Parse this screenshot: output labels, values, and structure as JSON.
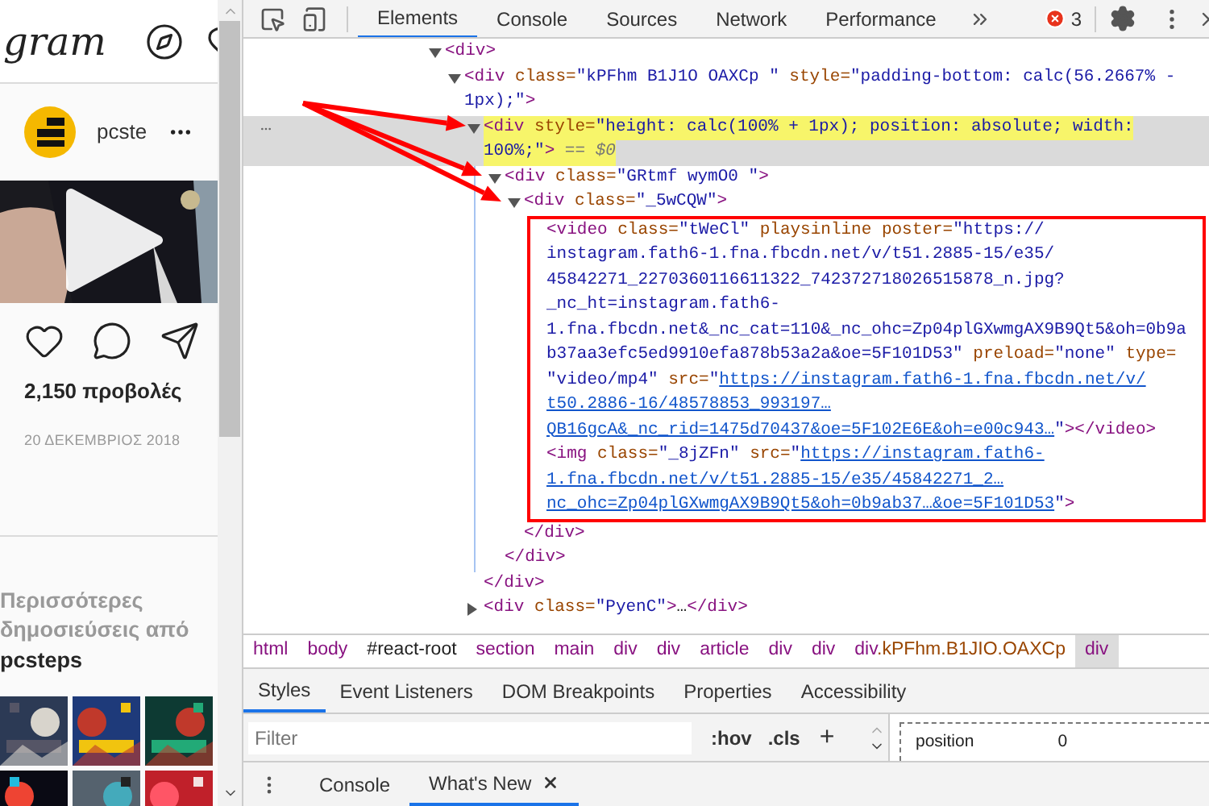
{
  "page": {
    "logo": "gram",
    "post": {
      "username": "pcste",
      "views": "2,150 προβολές",
      "date": "20 ΔΕΚΕΜΒΡΙΟΣ 2018"
    },
    "more": {
      "heading": "Περισσότερες δημοσιεύσεις από",
      "account": "pcsteps"
    }
  },
  "devtools": {
    "tabs": [
      {
        "label": "Elements",
        "selected": true
      },
      {
        "label": "Console",
        "selected": false
      },
      {
        "label": "Sources",
        "selected": false
      },
      {
        "label": "Network",
        "selected": false
      },
      {
        "label": "Performance",
        "selected": false
      }
    ],
    "error_count": "3",
    "annotations": {
      "arrows": true
    },
    "dom": {
      "kind": "parent",
      "expanded": true,
      "selected": false,
      "lines": [
        [
          {
            "kind": "tag",
            "text": "<div>"
          }
        ]
      ],
      "children": [
        {
          "kind": "parent",
          "expanded": true,
          "selected": false,
          "lines": [
            [
              {
                "kind": "tag",
                "text": "<div"
              },
              {
                "kind": "attr",
                "text": " class"
              },
              {
                "kind": "eq",
                "text": "="
              },
              {
                "kind": "val",
                "text": "\"kPFhm B1J1O OAXCp \""
              },
              {
                "kind": "attr",
                "text": " style"
              },
              {
                "kind": "eq",
                "text": "="
              },
              {
                "kind": "val",
                "text": "\"padding-bottom: calc(56.2667% -"
              }
            ],
            [
              {
                "kind": "val",
                "text": "1px);\""
              },
              {
                "kind": "tag",
                "text": ">"
              }
            ]
          ],
          "children": [
            {
              "kind": "parent",
              "expanded": true,
              "selected": true,
              "highlighted": true,
              "lines": [
                [
                  {
                    "kind": "tag",
                    "text": "<div"
                  },
                  {
                    "kind": "attr",
                    "text": " style"
                  },
                  {
                    "kind": "eq",
                    "text": "="
                  },
                  {
                    "kind": "val",
                    "text": "\"height: calc(100% + 1px); position: absolute; width:"
                  }
                ],
                [
                  {
                    "kind": "val",
                    "text": "100%;\""
                  },
                  {
                    "kind": "tag",
                    "text": ">"
                  },
                  {
                    "kind": "ref",
                    "text": " == $0"
                  }
                ]
              ],
              "children": [
                {
                  "kind": "parent",
                  "expanded": true,
                  "selected": false,
                  "lines": [
                    [
                      {
                        "kind": "tag",
                        "text": "<div"
                      },
                      {
                        "kind": "attr",
                        "text": " class"
                      },
                      {
                        "kind": "eq",
                        "text": "="
                      },
                      {
                        "kind": "val",
                        "text": "\"GRtmf wymO0 \""
                      },
                      {
                        "kind": "tag",
                        "text": ">"
                      }
                    ]
                  ],
                  "children": [
                    {
                      "kind": "parent",
                      "expanded": true,
                      "selected": false,
                      "boxed_children": true,
                      "lines": [
                        [
                          {
                            "kind": "tag",
                            "text": "<div"
                          },
                          {
                            "kind": "attr",
                            "text": " class"
                          },
                          {
                            "kind": "eq",
                            "text": "="
                          },
                          {
                            "kind": "val",
                            "text": "\"_5wCQW\""
                          },
                          {
                            "kind": "tag",
                            "text": ">"
                          }
                        ]
                      ],
                      "children": [
                        {
                          "kind": "leaf",
                          "selected": false,
                          "lines": [
                            [
                              {
                                "kind": "tag",
                                "text": "<video"
                              },
                              {
                                "kind": "attr",
                                "text": " class"
                              },
                              {
                                "kind": "eq",
                                "text": "="
                              },
                              {
                                "kind": "val",
                                "text": "\"tWeCl\""
                              },
                              {
                                "kind": "attr",
                                "text": " playsinline poster"
                              },
                              {
                                "kind": "eq",
                                "text": "="
                              },
                              {
                                "kind": "val",
                                "text": "\"https://"
                              }
                            ],
                            [
                              {
                                "kind": "val",
                                "text": "instagram.fath6-1.fna.fbcdn.net/v/t51.2885-15/e35/"
                              }
                            ],
                            [
                              {
                                "kind": "val",
                                "text": "45842271_2270360116611322_742372718026515878_n.jpg?"
                              }
                            ],
                            [
                              {
                                "kind": "val",
                                "text": "_nc_ht=instagram.fath6-"
                              }
                            ],
                            [
                              {
                                "kind": "val",
                                "text": "1.fna.fbcdn.net&_nc_cat=110&_nc_ohc=Zp04plGXwmgAX9B9Qt5&oh=0b9a"
                              }
                            ],
                            [
                              {
                                "kind": "val",
                                "text": "b37aa3efc5ed9910efa878b53a2a&oe=5F101D53\""
                              },
                              {
                                "kind": "attr",
                                "text": " preload"
                              },
                              {
                                "kind": "eq",
                                "text": "="
                              },
                              {
                                "kind": "val",
                                "text": "\"none\""
                              },
                              {
                                "kind": "attr",
                                "text": " type"
                              },
                              {
                                "kind": "eq",
                                "text": "="
                              }
                            ],
                            [
                              {
                                "kind": "val",
                                "text": "\"video/mp4\""
                              },
                              {
                                "kind": "attr",
                                "text": " src"
                              },
                              {
                                "kind": "eq",
                                "text": "="
                              },
                              {
                                "kind": "val",
                                "text": "\""
                              },
                              {
                                "kind": "link",
                                "text": "https://instagram.fath6-1.fna.fbcdn.net/v/"
                              }
                            ],
                            [
                              {
                                "kind": "link",
                                "text": "t50.2886-16/48578853_993197…"
                              }
                            ],
                            [
                              {
                                "kind": "link",
                                "text": "QB16gcA&_nc_rid=1475d70437&oe=5F102E6E&oh=e00c943…"
                              },
                              {
                                "kind": "val",
                                "text": "\""
                              },
                              {
                                "kind": "tag",
                                "text": "></video>"
                              }
                            ]
                          ]
                        },
                        {
                          "kind": "leaf",
                          "selected": false,
                          "lines": [
                            [
                              {
                                "kind": "tag",
                                "text": "<img"
                              },
                              {
                                "kind": "attr",
                                "text": " class"
                              },
                              {
                                "kind": "eq",
                                "text": "="
                              },
                              {
                                "kind": "val",
                                "text": "\"_8jZFn\""
                              },
                              {
                                "kind": "attr",
                                "text": " src"
                              },
                              {
                                "kind": "eq",
                                "text": "="
                              },
                              {
                                "kind": "val",
                                "text": "\""
                              },
                              {
                                "kind": "link",
                                "text": "https://instagram.fath6-"
                              }
                            ],
                            [
                              {
                                "kind": "link",
                                "text": "1.fna.fbcdn.net/v/t51.2885-15/e35/45842271_2…"
                              }
                            ],
                            [
                              {
                                "kind": "link",
                                "text": "nc_ohc=Zp04plGXwmgAX9B9Qt5&oh=0b9ab37…&oe=5F101D53"
                              },
                              {
                                "kind": "val",
                                "text": "\""
                              },
                              {
                                "kind": "tag",
                                "text": ">"
                              }
                            ]
                          ]
                        }
                      ],
                      "close": [
                        {
                          "kind": "tag",
                          "text": "</div>"
                        }
                      ]
                    }
                  ],
                  "close": [
                    {
                      "kind": "tag",
                      "text": "</div>"
                    }
                  ]
                }
              ],
              "close": [
                {
                  "kind": "tag",
                  "text": "</div>"
                }
              ]
            },
            {
              "kind": "parent",
              "expanded": false,
              "selected": false,
              "lines": [
                [
                  {
                    "kind": "tag",
                    "text": "<div"
                  },
                  {
                    "kind": "attr",
                    "text": " class"
                  },
                  {
                    "kind": "eq",
                    "text": "="
                  },
                  {
                    "kind": "val",
                    "text": "\"PyenC\""
                  },
                  {
                    "kind": "tag",
                    "text": ">"
                  },
                  {
                    "kind": "text",
                    "text": "…"
                  },
                  {
                    "kind": "tag",
                    "text": "</div>"
                  }
                ]
              ]
            }
          ]
        }
      ]
    },
    "breadcrumbs": [
      {
        "kind": "tag",
        "text": "html",
        "selected": false
      },
      {
        "kind": "tag",
        "text": "body",
        "selected": false
      },
      {
        "kind": "id",
        "text": "#react-root",
        "selected": false
      },
      {
        "kind": "tag",
        "text": "section",
        "selected": false
      },
      {
        "kind": "tag",
        "text": "main",
        "selected": false
      },
      {
        "kind": "tag",
        "text": "div",
        "selected": false
      },
      {
        "kind": "tag",
        "text": "div",
        "selected": false
      },
      {
        "kind": "tag",
        "text": "article",
        "selected": false
      },
      {
        "kind": "tag",
        "text": "div",
        "selected": false
      },
      {
        "kind": "tag",
        "text": "div",
        "selected": false
      },
      {
        "kind": "tag",
        "text": "div",
        "classes": ".kPFhm.B1JIO.OAXCp",
        "selected": false
      },
      {
        "kind": "tag",
        "text": "div",
        "selected": true
      }
    ],
    "panel_tabs": [
      {
        "label": "Styles",
        "selected": true
      },
      {
        "label": "Event Listeners",
        "selected": false
      },
      {
        "label": "DOM Breakpoints",
        "selected": false
      },
      {
        "label": "Properties",
        "selected": false
      },
      {
        "label": "Accessibility",
        "selected": false
      }
    ],
    "filter": {
      "placeholder": "Filter"
    },
    "hov": ":hov",
    "cls": ".cls",
    "add_rule": "+",
    "box_model": {
      "label": "position",
      "value": "0"
    },
    "drawer_tabs": [
      {
        "label": "Console",
        "selected": false,
        "closable": false
      },
      {
        "label": "What's New",
        "selected": true,
        "closable": true
      }
    ]
  }
}
